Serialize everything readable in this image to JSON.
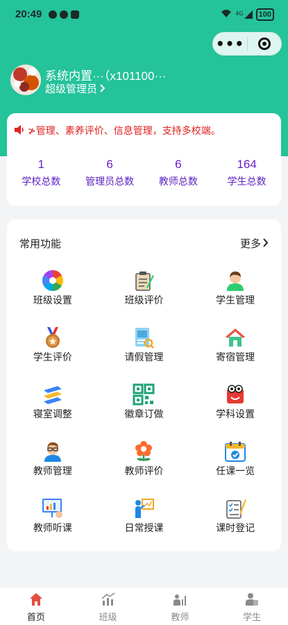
{
  "status_bar": {
    "time": "20:49",
    "battery": "100",
    "network": "4G"
  },
  "capsule": {
    "more_icon": "more-dots-icon",
    "close_icon": "target-close-icon"
  },
  "user": {
    "name": "系统内置···（x101100···",
    "role": "超级管理员"
  },
  "notice": {
    "text": "≯管理、素养评价、信息管理，支持多校端。",
    "color": "#e02020"
  },
  "stats": [
    {
      "value": "1",
      "label": "学校总数"
    },
    {
      "value": "6",
      "label": "管理员总数"
    },
    {
      "value": "6",
      "label": "教师总数"
    },
    {
      "value": "164",
      "label": "学生总数"
    }
  ],
  "functions": {
    "title": "常用功能",
    "more": "更多",
    "items": [
      {
        "label": "班级设置",
        "icon": "aperture-icon"
      },
      {
        "label": "班级评价",
        "icon": "clipboard-pen-icon"
      },
      {
        "label": "学生管理",
        "icon": "student-avatar-icon"
      },
      {
        "label": "学生评价",
        "icon": "medal-icon"
      },
      {
        "label": "请假管理",
        "icon": "leave-form-icon"
      },
      {
        "label": "寄宿管理",
        "icon": "house-icon"
      },
      {
        "label": "寝室调整",
        "icon": "bunk-bed-icon"
      },
      {
        "label": "徽章订做",
        "icon": "qr-code-icon"
      },
      {
        "label": "学科设置",
        "icon": "book-mascot-icon"
      },
      {
        "label": "教师管理",
        "icon": "teacher-avatar-icon"
      },
      {
        "label": "教师评价",
        "icon": "flower-icon"
      },
      {
        "label": "任课一览",
        "icon": "calendar-check-icon"
      },
      {
        "label": "教师听课",
        "icon": "presentation-board-icon"
      },
      {
        "label": "日常授课",
        "icon": "teaching-icon"
      },
      {
        "label": "课时登记",
        "icon": "checklist-pencil-icon"
      }
    ]
  },
  "tabs": [
    {
      "label": "首页",
      "icon": "home-icon",
      "active": true
    },
    {
      "label": "班级",
      "icon": "chart-icon",
      "active": false
    },
    {
      "label": "教师",
      "icon": "teacher-chart-icon",
      "active": false
    },
    {
      "label": "学生",
      "icon": "student-icon",
      "active": false
    }
  ],
  "colors": {
    "header": "#24c39a",
    "stat_text": "#6a1cc9",
    "tab_active": "#e54d42",
    "tab_inactive": "#8a8a8a"
  }
}
